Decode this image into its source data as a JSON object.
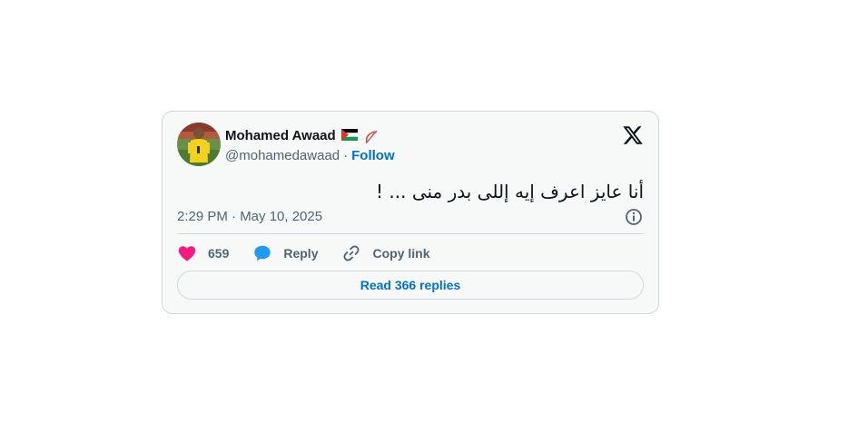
{
  "tweet": {
    "author": {
      "name": "Mohamed Awaad",
      "handle": "@mohamedawaad",
      "separator": "·",
      "follow_label": "Follow",
      "badges": [
        "palestine-flag",
        "bow-and-arrow"
      ]
    },
    "text": "أنا عايز اعرف إيه إللى بدر منى ... !",
    "timestamp": "2:29 PM · May 10, 2025",
    "actions": {
      "likes_count": "659",
      "reply_label": "Reply",
      "copy_link_label": "Copy link"
    },
    "read_replies_label": "Read 366 replies"
  },
  "colors": {
    "heart": "#f91880",
    "reply_bubble": "#1d9bf0",
    "link": "#006fd6",
    "muted_text": "#536471",
    "card_bg": "#f7f9f9",
    "border": "#cfd9de"
  },
  "icons": [
    "x-logo-icon",
    "info-icon",
    "heart-icon",
    "reply-bubble-icon",
    "link-icon"
  ]
}
